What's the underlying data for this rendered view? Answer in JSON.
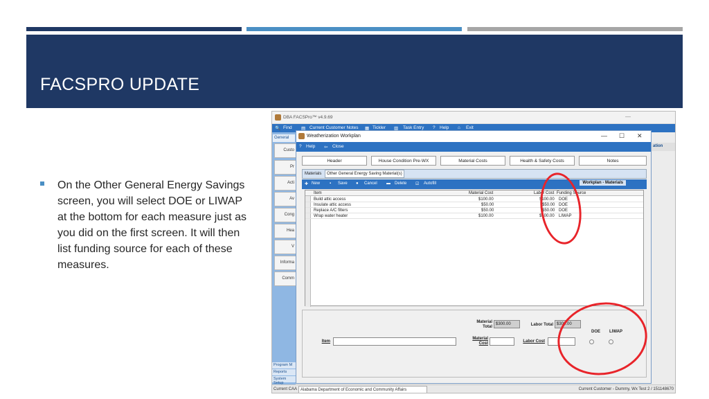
{
  "slide": {
    "title": "FACSPRO UPDATE",
    "bullet": "On the Other General Energy Savings screen, you will select DOE or LIWAP at the bottom for each measure just as you did on the first screen. It will then list funding source for each of these measures."
  },
  "app": {
    "title": "DBA FACSPro™ v4.9.69",
    "menu": [
      "Find",
      "Current Customer Notes",
      "Tickler",
      "Task Entry",
      "Help",
      "Exit"
    ],
    "left_tabs": [
      "General"
    ],
    "left_buttons": [
      "Custo",
      "Pr",
      "Acti",
      "Av",
      "Cong",
      "Hea",
      "V",
      "Informa",
      "Comm"
    ],
    "left_bottom": [
      "Program M",
      "Reports",
      "System Setup"
    ],
    "right_strip": "ation",
    "status_left": "Current CAA",
    "status_agency": "Alabama Department of Economic and Community Affairs",
    "status_right": "Current Customer - Dummy, Wx Test 2 / 151148670"
  },
  "dialog": {
    "title": "Weatherization Workplan",
    "controls": [
      "—",
      "☐",
      "✕"
    ],
    "toolbar": [
      "Help",
      "Close"
    ],
    "tabs": [
      "Header",
      "House Condition Pre-WX",
      "Material Costs",
      "Health & Safety Costs",
      "Notes"
    ],
    "sub_tabs": [
      "Materials",
      "Other General Energy Saving Material(s)"
    ],
    "sub_toolbar": [
      "New",
      "Save",
      "Cancel",
      "Delete",
      "Autofill"
    ],
    "sub_heading": "Workplan - Materials",
    "grid": {
      "columns": [
        "Item",
        "Material Cost",
        "Labor Cost",
        "Funding Source"
      ],
      "rows": [
        {
          "item": "Build attic access",
          "material": "$100.00",
          "labor": "$100.00",
          "source": "DOE"
        },
        {
          "item": "Insulate attic access",
          "material": "$50.00",
          "labor": "$50.00",
          "source": "DOE"
        },
        {
          "item": "Replace A/C filters",
          "material": "$50.00",
          "labor": "$50.00",
          "source": "DOE"
        },
        {
          "item": "Wrap water heater",
          "material": "$100.00",
          "labor": "$100.00",
          "source": "LIWAP"
        }
      ]
    },
    "form": {
      "material_total_label": "Material Total",
      "material_total": "$300.00",
      "labor_total_label": "Labor Total",
      "labor_total": "$300.00",
      "item_label": "Item",
      "material_cost_label": "Material Cost",
      "labor_cost_label": "Labor Cost",
      "doe_label": "DOE",
      "liwap_label": "LIWAP"
    }
  },
  "colors": {
    "header_band": "#1f3864",
    "accent_blue": "#4a8fc4",
    "accent_gray": "#a6a6a6",
    "annotation_red": "#e8242a",
    "app_toolbar": "#2d72c2"
  }
}
